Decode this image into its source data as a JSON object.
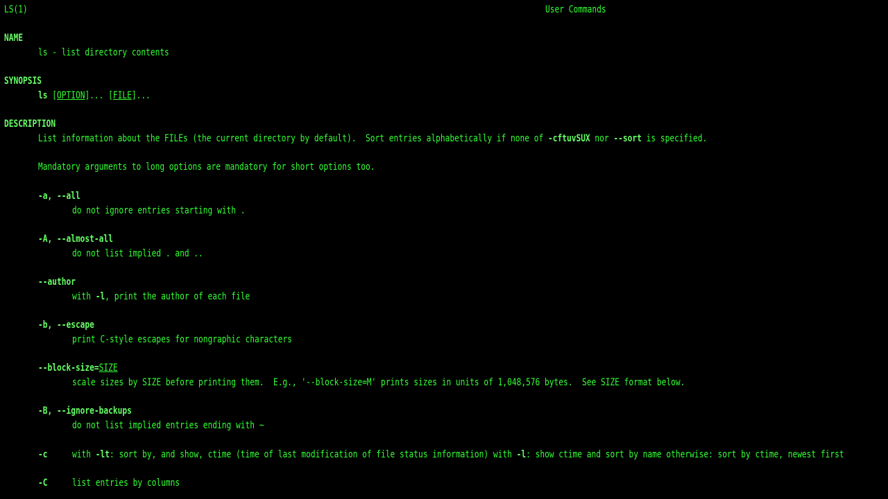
{
  "colors": {
    "background": "#000000",
    "text": "#33ff33",
    "bold_text": "#66ff66"
  },
  "header": {
    "left": "LS(1)",
    "center": "User Commands"
  },
  "sections": {
    "name": {
      "heading": "NAME",
      "text": "ls - list directory contents"
    },
    "synopsis": {
      "heading": "SYNOPSIS",
      "cmd": "ls",
      "sp1": " [",
      "opt": "OPTION",
      "mid": "]... [",
      "file": "FILE",
      "end": "]..."
    },
    "description": {
      "heading": "DESCRIPTION",
      "intro_a": "List information about the FILEs (the current directory by default).  Sort entries alphabetically if none of ",
      "intro_flag": "-cftuvSUX",
      "intro_b": " nor ",
      "intro_flag2": "--sort",
      "intro_c": " is specified.",
      "mandatory": "Mandatory arguments to long options are mandatory for short options too."
    }
  },
  "options": [
    {
      "flag": "-a, --all",
      "desc": "do not ignore entries starting with ."
    },
    {
      "flag": "-A, --almost-all",
      "desc": "do not list implied . and .."
    },
    {
      "flag": "--author",
      "desc_a": "with ",
      "desc_flag": "-l",
      "desc_b": ", print the author of each file"
    },
    {
      "flag": "-b, --escape",
      "desc": "print C-style escapes for nongraphic characters"
    },
    {
      "flag": "--block-size=",
      "arg": "SIZE",
      "desc": "scale sizes by SIZE before printing them.  E.g., '--block-size=M' prints sizes in units of 1,048,576 bytes.  See SIZE format below."
    },
    {
      "flag": "-B, --ignore-backups",
      "desc": "do not list implied entries ending with ~"
    },
    {
      "flag": "-c",
      "desc_a": "with ",
      "desc_flag": "-lt",
      "desc_b": ": sort by, and show, ctime (time of last modification of file status information) with ",
      "desc_flag2": "-l",
      "desc_c": ": show ctime and sort by name otherwise: sort by ctime, newest first"
    },
    {
      "flag": "-C",
      "desc": "list entries by columns"
    }
  ]
}
